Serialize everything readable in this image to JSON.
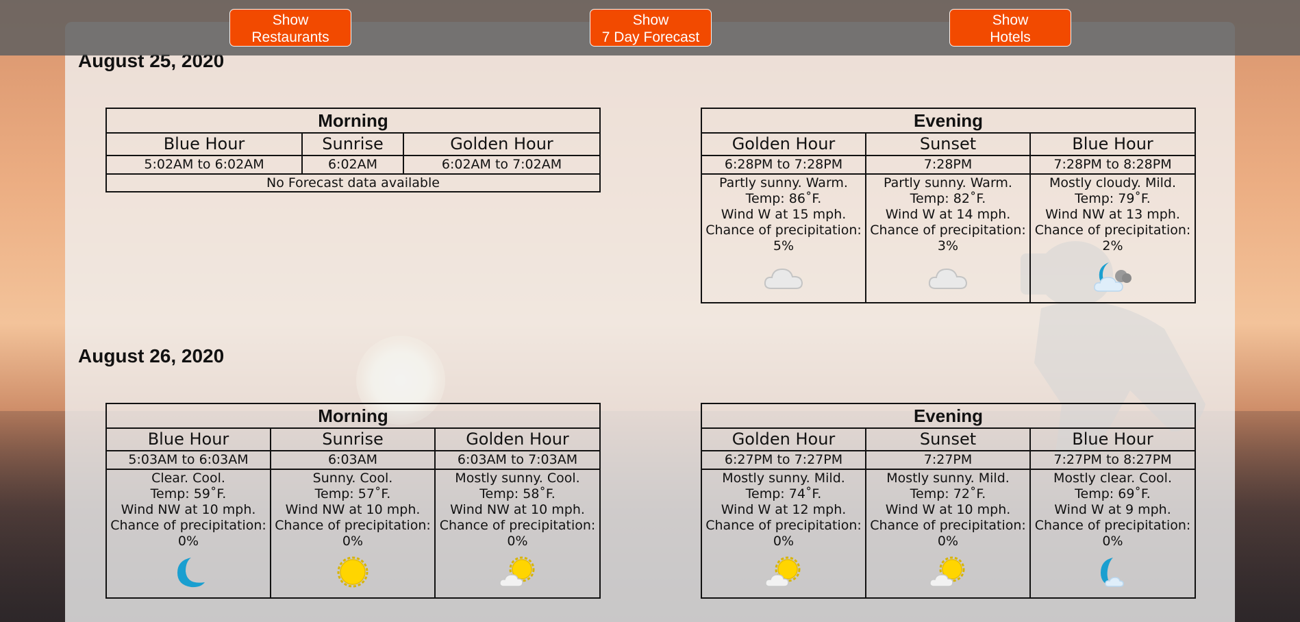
{
  "nav": {
    "restaurants": {
      "line1": "Show",
      "line2": "Restaurants"
    },
    "forecast": {
      "line1": "Show",
      "line2": "7 Day Forecast"
    },
    "hotels": {
      "line1": "Show",
      "line2": "Hotels"
    }
  },
  "days": [
    {
      "date": "August 25, 2020",
      "morning": {
        "title": "Morning",
        "columns": [
          {
            "name": "Blue Hour",
            "time": "5:02AM to 6:02AM"
          },
          {
            "name": "Sunrise",
            "time": "6:02AM"
          },
          {
            "name": "Golden Hour",
            "time": "6:02AM to 7:02AM"
          }
        ],
        "message": "No Forecast data available"
      },
      "evening": {
        "title": "Evening",
        "columns": [
          {
            "name": "Golden Hour",
            "time": "6:28PM to 7:28PM",
            "condition": "Partly sunny. Warm.",
            "temp": "Temp: 86˚F.",
            "wind": "Wind W at 15 mph.",
            "precip_label": "Chance of precipitation:",
            "precip": "5%",
            "icon": "cloudy-icon"
          },
          {
            "name": "Sunset",
            "time": "7:28PM",
            "condition": "Partly sunny. Warm.",
            "temp": "Temp: 82˚F.",
            "wind": "Wind W at 14 mph.",
            "precip_label": "Chance of precipitation:",
            "precip": "3%",
            "icon": "cloudy-icon"
          },
          {
            "name": "Blue Hour",
            "time": "7:28PM to 8:28PM",
            "condition": "Mostly cloudy. Mild.",
            "temp": "Temp: 79˚F.",
            "wind": "Wind NW at 13 mph.",
            "precip_label": "Chance of precipitation:",
            "precip": "2%",
            "icon": "night-cloudy-icon"
          }
        ]
      }
    },
    {
      "date": "August 26, 2020",
      "morning": {
        "title": "Morning",
        "columns": [
          {
            "name": "Blue Hour",
            "time": "5:03AM to 6:03AM",
            "condition": "Clear. Cool.",
            "temp": "Temp: 59˚F.",
            "wind": "Wind NW at 10 mph.",
            "precip_label": "Chance of precipitation:",
            "precip": "0%",
            "icon": "moon-icon"
          },
          {
            "name": "Sunrise",
            "time": "6:03AM",
            "condition": "Sunny. Cool.",
            "temp": "Temp: 57˚F.",
            "wind": "Wind NW at 10 mph.",
            "precip_label": "Chance of precipitation:",
            "precip": "0%",
            "icon": "sun-icon"
          },
          {
            "name": "Golden Hour",
            "time": "6:03AM to 7:03AM",
            "condition": "Mostly sunny. Cool.",
            "temp": "Temp: 58˚F.",
            "wind": "Wind NW at 10 mph.",
            "precip_label": "Chance of precipitation:",
            "precip": "0%",
            "icon": "mostly-sunny-icon"
          }
        ]
      },
      "evening": {
        "title": "Evening",
        "columns": [
          {
            "name": "Golden Hour",
            "time": "6:27PM to 7:27PM",
            "condition": "Mostly sunny. Mild.",
            "temp": "Temp: 74˚F.",
            "wind": "Wind W at 12 mph.",
            "precip_label": "Chance of precipitation:",
            "precip": "0%",
            "icon": "mostly-sunny-icon"
          },
          {
            "name": "Sunset",
            "time": "7:27PM",
            "condition": "Mostly sunny. Mild.",
            "temp": "Temp: 72˚F.",
            "wind": "Wind W at 10 mph.",
            "precip_label": "Chance of precipitation:",
            "precip": "0%",
            "icon": "mostly-sunny-icon"
          },
          {
            "name": "Blue Hour",
            "time": "7:27PM to 8:27PM",
            "condition": "Mostly clear. Cool.",
            "temp": "Temp: 69˚F.",
            "wind": "Wind W at 9 mph.",
            "precip_label": "Chance of precipitation:",
            "precip": "0%",
            "icon": "night-clear-icon"
          }
        ]
      }
    }
  ],
  "colors": {
    "button": "#f24a00",
    "topbar": "#5f5f5f",
    "moon": "#1a9fd0",
    "sun": "#ffd500"
  }
}
